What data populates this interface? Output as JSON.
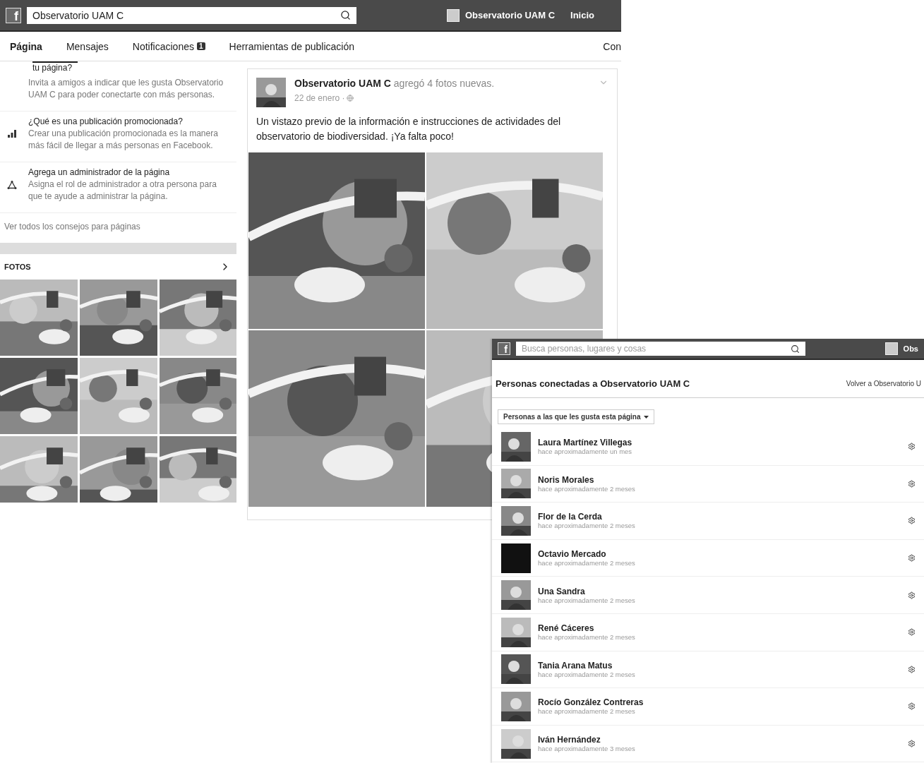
{
  "main_window": {
    "topbar": {
      "logo": "f",
      "search_value": "Observatorio UAM C",
      "page_name": "Observatorio UAM C",
      "home": "Inicio"
    },
    "tabs": [
      {
        "label": "Página",
        "selected": true
      },
      {
        "label": "Mensajes",
        "selected": false
      },
      {
        "label": "Notificaciones",
        "selected": false,
        "badge": "1"
      },
      {
        "label": "Herramientas de publicación",
        "selected": false
      },
      {
        "label": "Con",
        "selected": false
      }
    ],
    "tips": {
      "cut_title": "tu página?",
      "items": [
        {
          "kind": "invite",
          "text": "Invita a amigos a indicar que les gusta Observatorio UAM C para poder conectarte con más personas."
        },
        {
          "kind": "promote",
          "title": "¿Qué es una publicación promocionada?",
          "text": "Crear una publicación promocionada es la manera más fácil de llegar a más personas en Facebook."
        },
        {
          "kind": "admin",
          "title": "Agrega un administrador de la página",
          "text": "Asigna el rol de administrador a otra persona para que te ayude a administrar la página."
        }
      ],
      "link": "Ver todos los consejos para páginas"
    },
    "photos": {
      "title": "FOTOS"
    },
    "post": {
      "headline": "**Observatorio UAM C** agregó 4 fotos nuevas.",
      "date": "22 de enero ·",
      "text": "Un vistazo previo de la información e instrucciones de actividades del observatorio de biodiversidad. ¡Ya falta poco!"
    }
  },
  "people_window": {
    "topbar": {
      "logo": "f",
      "search_placeholder": "Busca personas, lugares y cosas",
      "page_name": "Obs"
    },
    "title": "Personas conectadas a Observatorio UAM C",
    "back_link": "Volver a Observatorio U",
    "filter": "Personas a las que les gusta esta página",
    "people": [
      {
        "name": "Laura Martínez Villegas",
        "time": "hace aproximadamente un mes"
      },
      {
        "name": "Noris Morales",
        "time": "hace aproximadamente 2 meses"
      },
      {
        "name": "Flor de la Cerda",
        "time": "hace aproximadamente 2 meses"
      },
      {
        "name": "Octavio Mercado",
        "time": "hace aproximadamente 2 meses",
        "avatar": {
          "kind": "blank"
        }
      },
      {
        "name": "Una Sandra",
        "time": "hace aproximadamente 2 meses"
      },
      {
        "name": "René Cáceres",
        "time": "hace aproximadamente 2 meses"
      },
      {
        "name": "Tania Arana Matus",
        "time": "hace aproximadamente 2 meses"
      },
      {
        "name": "Rocío González Contreras",
        "time": "hace aproximadamente 2 meses"
      },
      {
        "name": "Iván Hernández",
        "time": "hace aproximadamente 3 meses"
      }
    ]
  }
}
